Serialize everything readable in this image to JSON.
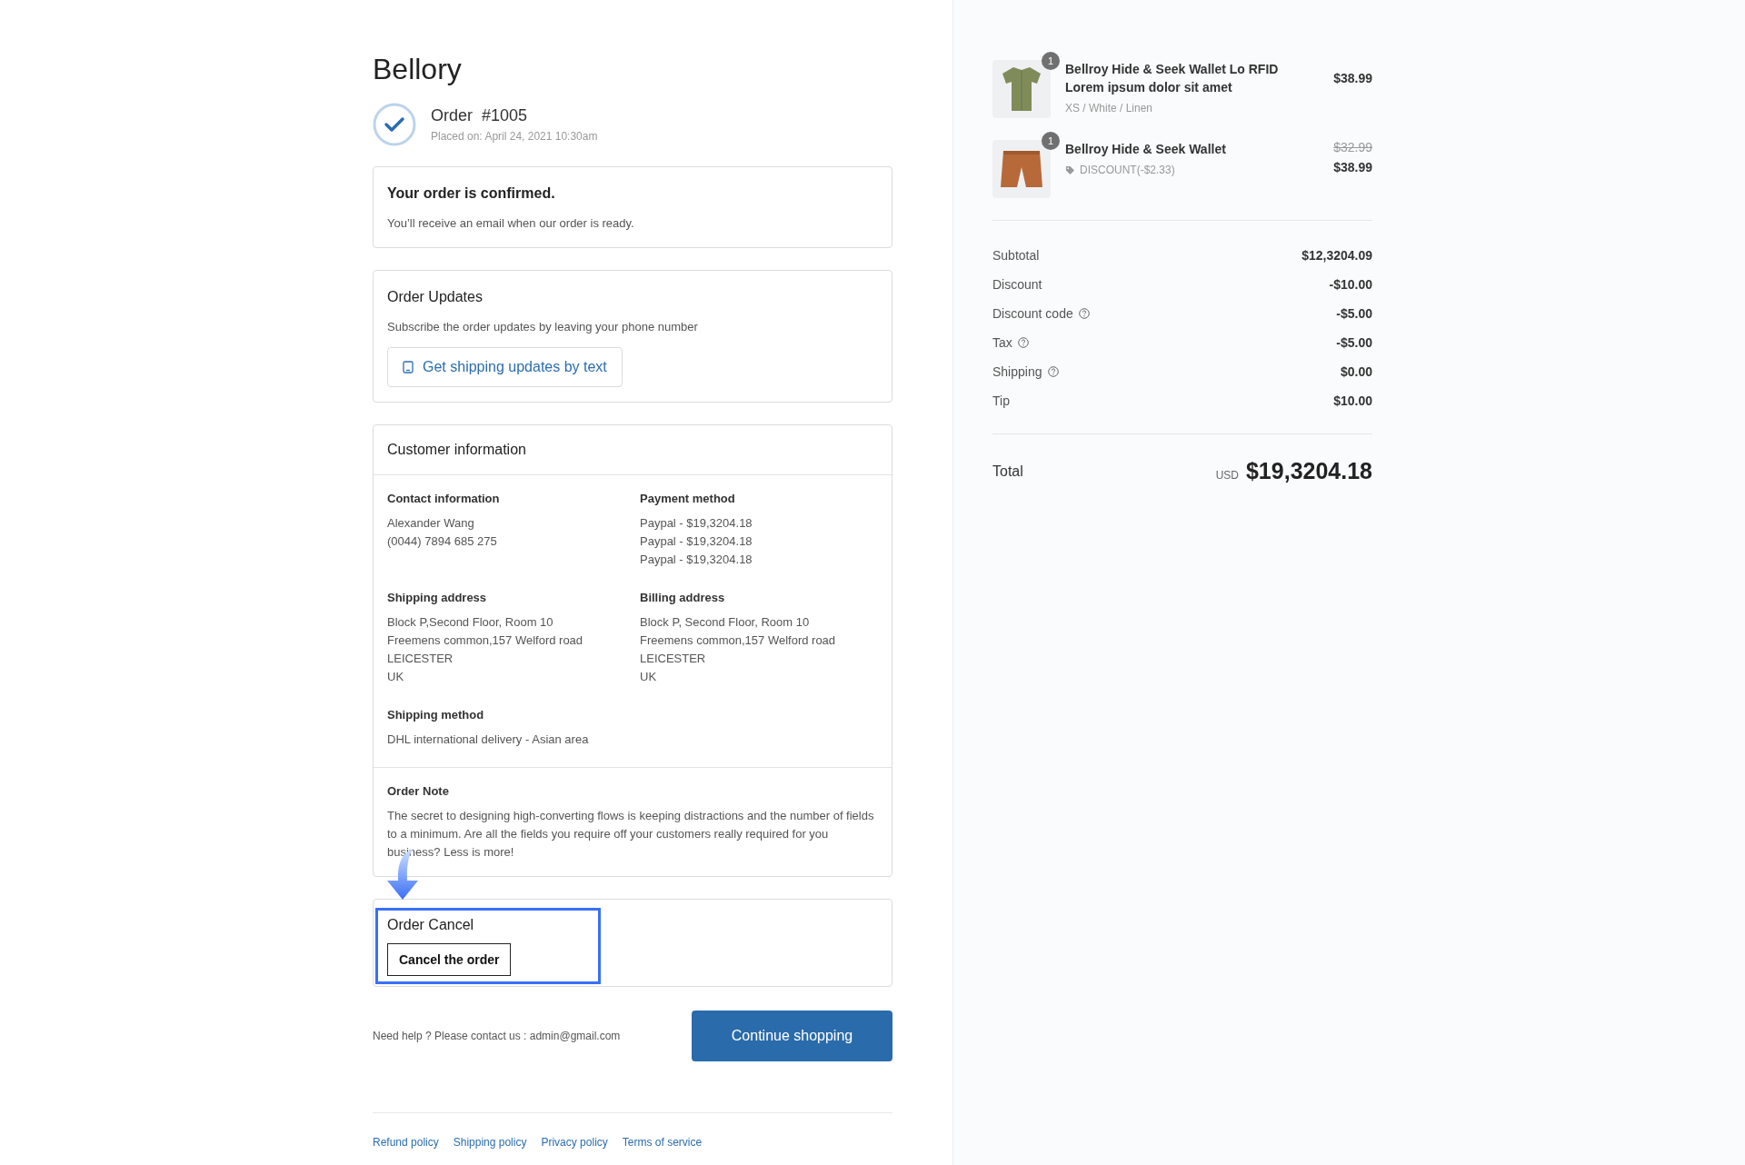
{
  "store": {
    "name": "Bellory"
  },
  "order": {
    "title": "Order  #1005",
    "placed": "Placed on: April 24, 2021 10:30am",
    "confirmed": true
  },
  "confirmation": {
    "title": "Your order is confirmed.",
    "text": "You’ll receive an email when our order is ready."
  },
  "updates": {
    "title": "Order Updates",
    "text": "Subscribe the order updates by leaving your phone number",
    "button": "Get shipping updates by text"
  },
  "customer": {
    "title": "Customer information",
    "sections": [
      {
        "title": "Contact information",
        "lines": [
          "Alexander Wang",
          "(0044) 7894 685 275"
        ]
      },
      {
        "title": "Payment method",
        "lines": [
          "Paypal - $19,3204.18",
          "Paypal - $19,3204.18",
          "Paypal - $19,3204.18"
        ]
      },
      {
        "title": "Shipping address",
        "lines": [
          "Block P,Second Floor, Room 10",
          "Freemens common,157 Welford road",
          "LEICESTER",
          "UK"
        ]
      },
      {
        "title": "Billing address",
        "lines": [
          "Block P, Second Floor, Room 10",
          "Freemens common,157 Welford road",
          "LEICESTER",
          "UK"
        ]
      },
      {
        "title": "Shipping method",
        "lines": [
          "DHL international delivery - Asian area"
        ]
      }
    ],
    "note": {
      "title": "Order Note",
      "text": "The secret to designing high-converting flows is keeping distractions and the number of fields to a minimum. Are all the fields you require off your customers really required for you business? Less is more!"
    }
  },
  "cancel": {
    "title": "Order Cancel",
    "button": "Cancel the order",
    "highlighted": true
  },
  "help": "Need help ? Please contact us : admin@gmail.com",
  "continue_button": "Continue shopping",
  "footer_links": [
    "Refund policy",
    "Shipping policy",
    "Privacy policy",
    "Terms of service"
  ],
  "items": [
    {
      "kind": "shirt",
      "quantity": "1",
      "name": "Bellroy Hide & Seek Wallet Lo RFID Lorem ipsum dolor sit amet",
      "variant": "XS / White / Linen",
      "price": "$38.99"
    },
    {
      "kind": "shorts",
      "quantity": "1",
      "name": "Bellroy Hide & Seek Wallet",
      "discount": "DISCOUNT(-$2.33)",
      "original_price": "$32.99",
      "price": "$38.99"
    }
  ],
  "summary": [
    {
      "label": "Subtotal",
      "value": "$12,3204.09",
      "info": false
    },
    {
      "label": "Discount",
      "value": "-$10.00",
      "info": false
    },
    {
      "label": "Discount code",
      "value": "-$5.00",
      "info": true
    },
    {
      "label": "Tax",
      "value": "-$5.00",
      "info": true
    },
    {
      "label": "Shipping",
      "value": "$0.00",
      "info": true
    },
    {
      "label": "Tip",
      "value": "$10.00",
      "info": false
    }
  ],
  "total": {
    "label": "Total",
    "currency": "USD",
    "value": "$19,3204.18"
  }
}
